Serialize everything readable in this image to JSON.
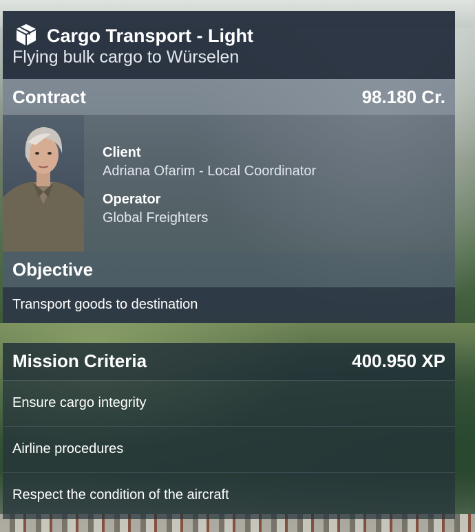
{
  "mission": {
    "title": "Cargo Transport - Light",
    "subtitle": "Flying bulk cargo to Würselen",
    "icon": "cargo-box-icon"
  },
  "contract": {
    "heading": "Contract",
    "reward": "98.180 Cr.",
    "client_label": "Client",
    "client_value": "Adriana Ofarim - Local Coordinator",
    "operator_label": "Operator",
    "operator_value": "Global Freighters"
  },
  "objective": {
    "heading": "Objective",
    "text": "Transport goods to destination"
  },
  "criteria": {
    "heading": "Mission Criteria",
    "xp": "400.950 XP",
    "items": [
      "Ensure cargo integrity",
      "Airline procedures",
      "Respect the condition of the aircraft"
    ]
  }
}
